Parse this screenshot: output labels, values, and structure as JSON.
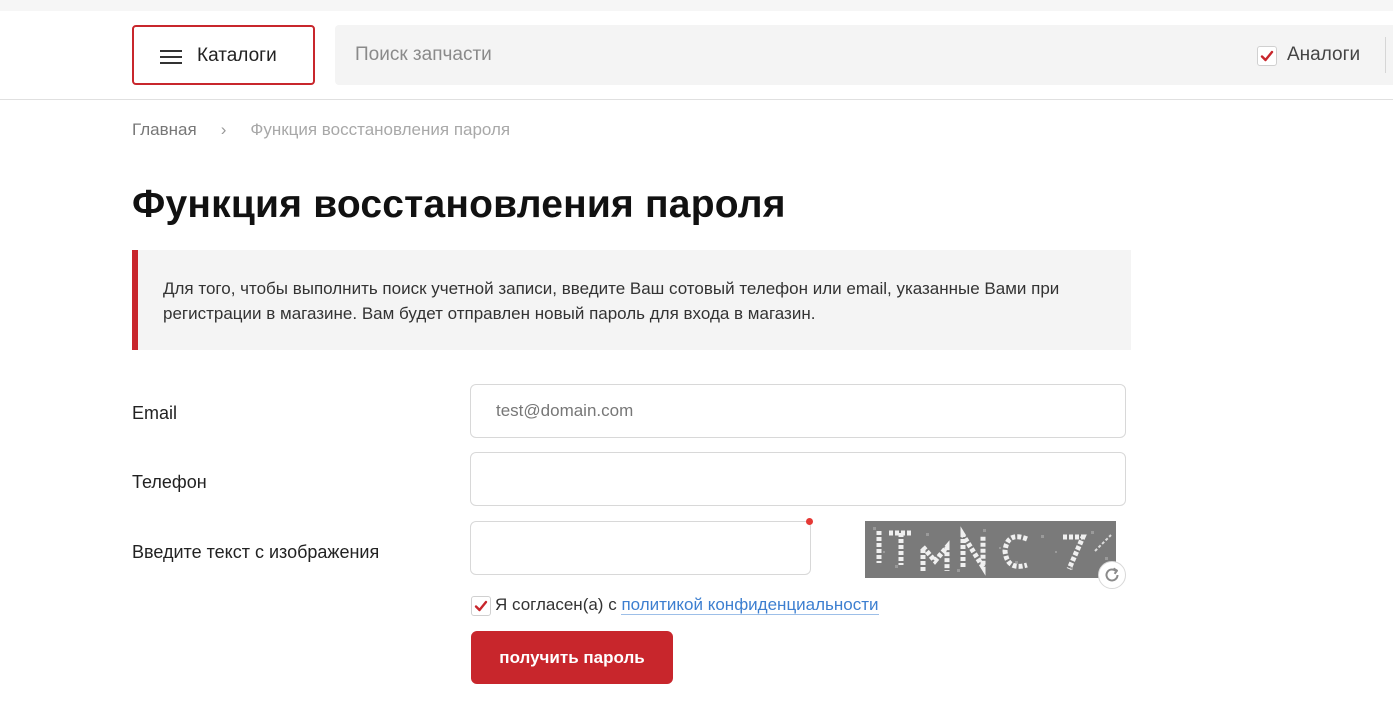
{
  "header": {
    "catalog_label": "Каталоги",
    "search_placeholder": "Поиск запчасти",
    "analogs_label": "Аналоги",
    "analogs_checked": true
  },
  "breadcrumb": {
    "home": "Главная",
    "separator": "›",
    "current": "Функция восстановления пароля"
  },
  "page": {
    "title": "Функция восстановления пароля",
    "info_text": "Для того, чтобы выполнить поиск учетной записи, введите Ваш сотовый телефон или email, указанные Вами при регистрации в магазине. Вам будет отправлен новый пароль для входа в магазин."
  },
  "form": {
    "email_label": "Email",
    "email_placeholder": "test@domain.com",
    "email_value": "",
    "phone_label": "Телефон",
    "phone_value": "",
    "captcha_label": "Введите текст с изображения",
    "captcha_value": "",
    "captcha_text": "JTMNC7",
    "agree_prefix": "Я согласен(а) с",
    "agree_link": "политикой конфиденциальности",
    "agree_checked": true,
    "submit_label": "получить пароль"
  },
  "colors": {
    "accent": "#c8262c",
    "link": "#3d7fd0",
    "info_bg": "#f4f4f4"
  }
}
